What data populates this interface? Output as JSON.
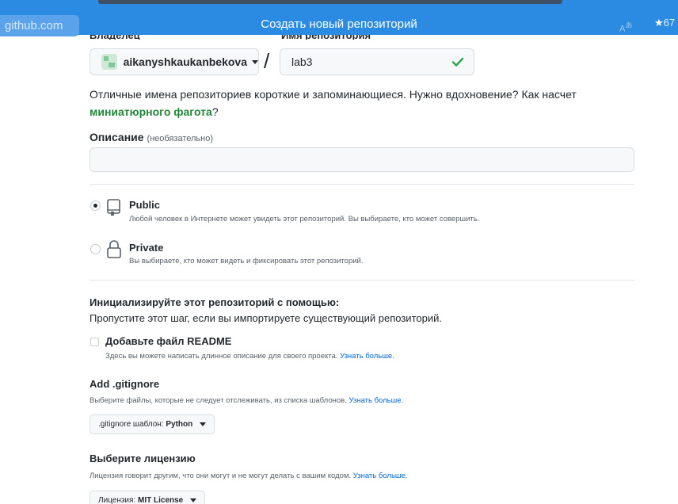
{
  "browser": {
    "host": "github.com",
    "tab_title": "Создать новый репозиторий",
    "star_count": "67"
  },
  "owner": {
    "label_clipped": "Владелец",
    "name": "aikanyshkaukanbekova"
  },
  "repo": {
    "label_clipped": "Имя репозитория",
    "name": "lab3"
  },
  "hint": {
    "text": "Отличные имена репозиториев короткие и запоминающиеся. Нужно вдохновение? Как насчет",
    "suggestion": "миниатюрного фагота",
    "suffix": "?"
  },
  "description": {
    "label": "Описание",
    "optional": "(необязательно)",
    "value": ""
  },
  "visibility": {
    "public": {
      "title": "Public",
      "desc": "Любой человек в Интернете может увидеть этот репозиторий. Вы выбираете, кто может совершить.",
      "selected": true
    },
    "private": {
      "title": "Private",
      "desc": "Вы выбираете, кто может видеть и фиксировать этот репозиторий.",
      "selected": false
    }
  },
  "init": {
    "title": "Инициализируйте этот репозиторий с помощью:",
    "subtitle": "Пропустите этот шаг, если вы импортируете существующий репозиторий."
  },
  "readme": {
    "label": "Добавьте файл README",
    "desc": "Здесь вы можете написать длинное описание для своего проекта.",
    "link": "Узнать больше.",
    "checked": false
  },
  "gitignore": {
    "title": "Add .gitignore",
    "desc": "Выберите файлы, которые не следует отслеживать, из списка шаблонов.",
    "link": "Узнать больше.",
    "select_prefix": ".gitignore шаблон:",
    "select_value": "Python"
  },
  "license": {
    "title": "Выберите лицензию",
    "desc": "Лицензия говорит другим, что они могут и не могут делать с вашим кодом.",
    "link": "Узнать больше.",
    "select_prefix": "Лицензия:",
    "select_value": "MIT License"
  },
  "colors": {
    "browser_bar": "#2b8be3",
    "link_green": "#22863a",
    "link_blue": "#0366d6",
    "check_green": "#28a745"
  }
}
